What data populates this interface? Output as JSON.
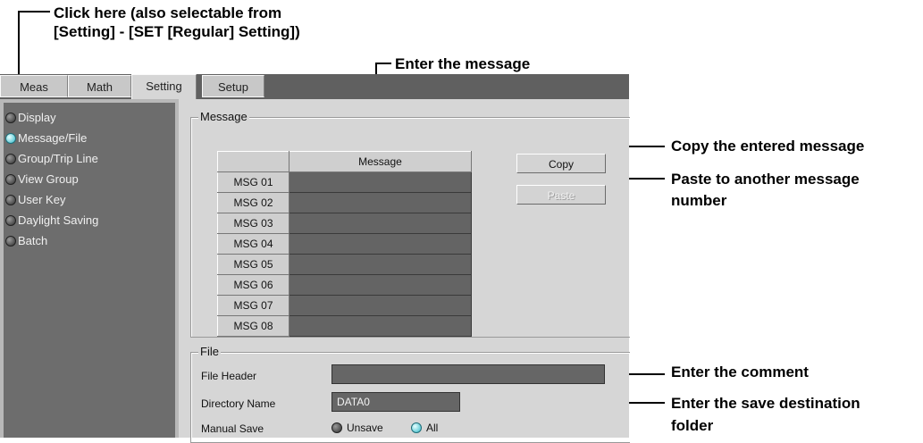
{
  "annotations": {
    "click_here_line1": "Click here (also selectable from",
    "click_here_line2": "[Setting] - [SET [Regular] Setting])",
    "enter_message": "Enter the message",
    "copy_entered": "Copy the entered message",
    "paste_line1": "Paste to another message",
    "paste_line2": "number",
    "enter_comment": "Enter the comment",
    "save_folder_line1": "Enter the save destination",
    "save_folder_line2": "folder"
  },
  "tabs": [
    {
      "label": "Meas"
    },
    {
      "label": "Math"
    },
    {
      "label": "Setting",
      "active": true
    },
    {
      "label": "Setup"
    }
  ],
  "sidebar": {
    "items": [
      {
        "label": "Display",
        "selected": false
      },
      {
        "label": "Message/File",
        "selected": true
      },
      {
        "label": "Group/Trip Line",
        "selected": false
      },
      {
        "label": "View Group",
        "selected": false
      },
      {
        "label": "User Key",
        "selected": false
      },
      {
        "label": "Daylight Saving",
        "selected": false
      },
      {
        "label": "Batch",
        "selected": false
      }
    ]
  },
  "message_group": {
    "title": "Message",
    "column_header": "Message",
    "rows": [
      {
        "label": "MSG 01",
        "value": ""
      },
      {
        "label": "MSG 02",
        "value": ""
      },
      {
        "label": "MSG 03",
        "value": ""
      },
      {
        "label": "MSG 04",
        "value": ""
      },
      {
        "label": "MSG 05",
        "value": ""
      },
      {
        "label": "MSG 06",
        "value": ""
      },
      {
        "label": "MSG 07",
        "value": ""
      },
      {
        "label": "MSG 08",
        "value": ""
      }
    ],
    "copy_label": "Copy",
    "paste_label": "Paste"
  },
  "file_group": {
    "title": "File",
    "file_header_label": "File Header",
    "file_header_value": "",
    "directory_label": "Directory Name",
    "directory_value": "DATA0",
    "manual_save_label": "Manual Save",
    "manual_save_options": [
      {
        "label": "Unsave",
        "selected": false
      },
      {
        "label": "All",
        "selected": true
      }
    ]
  },
  "colors": {
    "accent_radio": "#30b8c8",
    "panel_bg": "#d6d6d6",
    "sidebar_bg": "#6d6d6d",
    "field_bg": "#666666"
  }
}
